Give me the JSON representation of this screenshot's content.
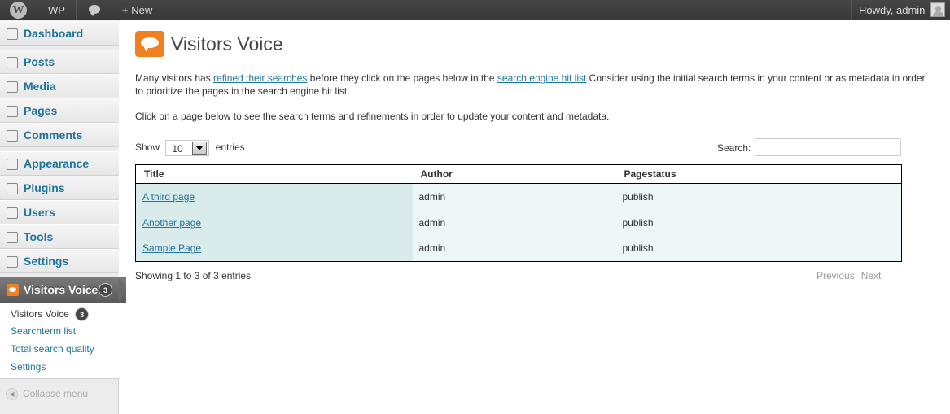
{
  "adminbar": {
    "wp_label": "WP",
    "new_label": "+ New",
    "greeting": "Howdy, admin"
  },
  "sidebar": {
    "items": [
      {
        "label": "Dashboard",
        "icon": "dashboard-icon"
      },
      {
        "label": "Posts",
        "icon": "pin-icon"
      },
      {
        "label": "Media",
        "icon": "media-icon"
      },
      {
        "label": "Pages",
        "icon": "pages-icon"
      },
      {
        "label": "Comments",
        "icon": "comment-icon"
      },
      {
        "label": "Appearance",
        "icon": "appearance-icon"
      },
      {
        "label": "Plugins",
        "icon": "plugin-icon"
      },
      {
        "label": "Users",
        "icon": "users-icon"
      },
      {
        "label": "Tools",
        "icon": "tools-icon"
      },
      {
        "label": "Settings",
        "icon": "settings-icon"
      }
    ],
    "current": {
      "label": "Visitors Voice",
      "count": "3"
    },
    "submenu": [
      {
        "label": "Visitors Voice",
        "count": "3"
      },
      {
        "label": "Searchterm list"
      },
      {
        "label": "Total search quality"
      },
      {
        "label": "Settings"
      }
    ],
    "collapse_label": "Collapse menu"
  },
  "main": {
    "title": "Visitors Voice",
    "intro_1": "Many visitors has ",
    "intro_link_1": "refined their searches",
    "intro_2": " before they click on the pages below in the ",
    "intro_link_2": "search engine hit list",
    "intro_3": ".Consider using the initial search terms in your content or as metadata in order to prioritize the pages in the search engine hit list.",
    "intro_line2": "Click on a page below to see the search terms and refinements in order to update your content and metadata.",
    "show_label": "Show",
    "show_value": "10",
    "entries_label": "entries",
    "search_label": "Search:",
    "search_value": "",
    "table": {
      "headers": [
        "Title",
        "Author",
        "Pagestatus"
      ],
      "rows": [
        [
          "A third page",
          "admin",
          "publish"
        ],
        [
          "Another page",
          "admin",
          "publish"
        ],
        [
          "Sample Page",
          "admin",
          "publish"
        ]
      ]
    },
    "info": "Showing 1 to 3 of 3 entries",
    "prev_label": "Previous",
    "next_label": "Next"
  },
  "colors": {
    "link": "#21759b",
    "accent": "#f07f1f",
    "adminbar": "#464646"
  }
}
